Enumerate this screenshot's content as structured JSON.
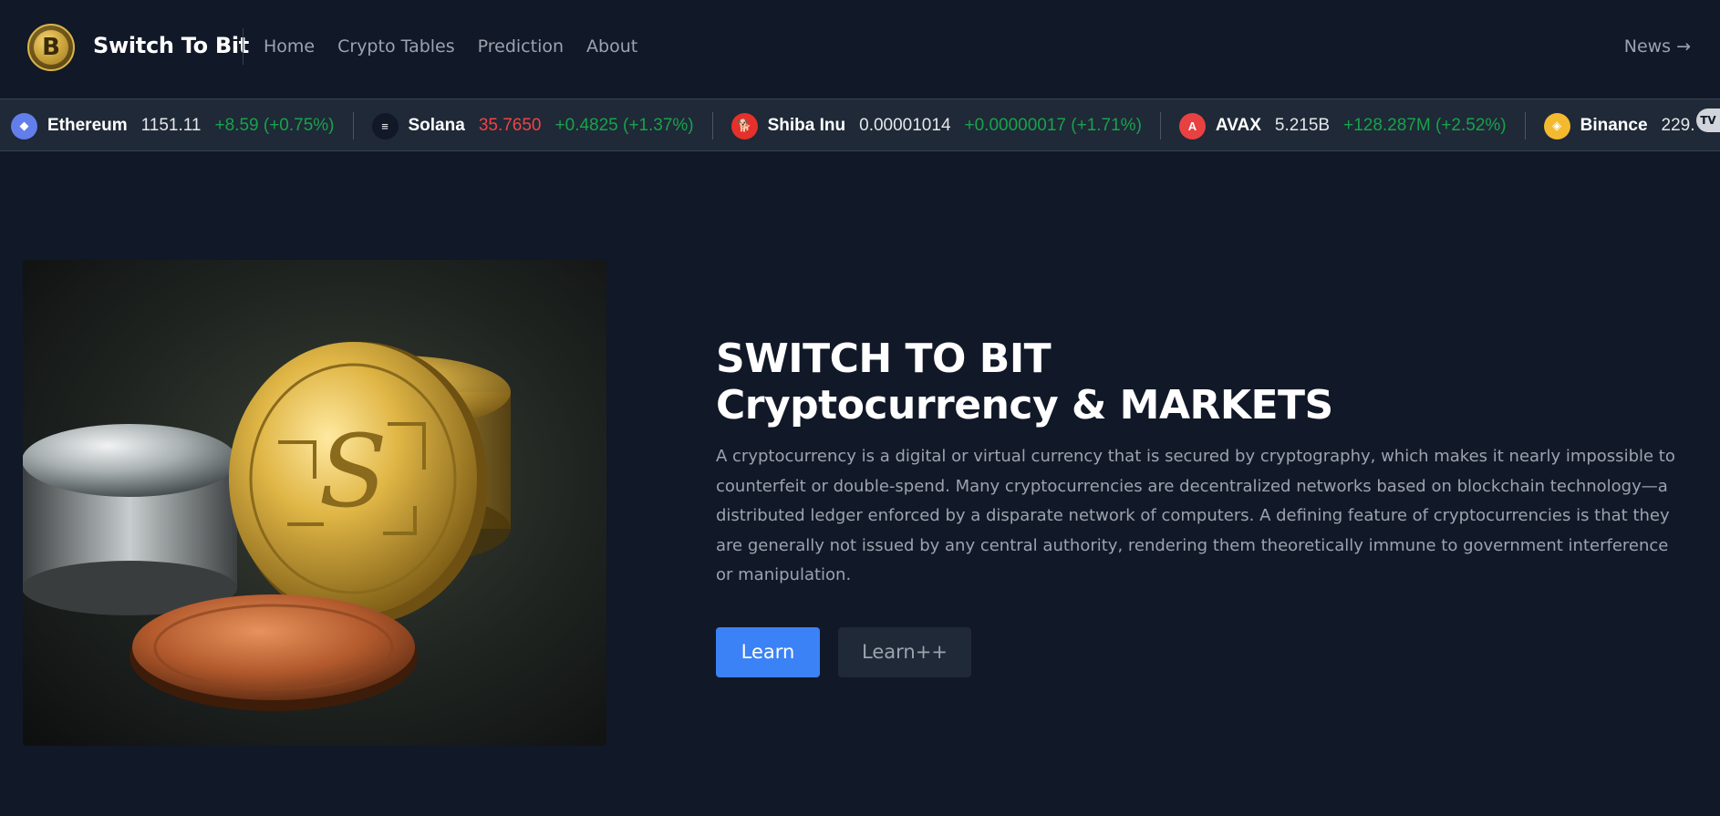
{
  "nav": {
    "logo_glyph": "B",
    "brand": "Switch To Bit",
    "links": [
      "Home",
      "Crypto Tables",
      "Prediction",
      "About"
    ],
    "news_label": "News",
    "news_arrow": "→"
  },
  "ticker": {
    "items": [
      {
        "icon": "ethereum-icon",
        "icon_glyph": "◆",
        "color": "#627eea",
        "name": "Ethereum",
        "price": "1151.11",
        "price_trend": "neutral",
        "change": "+8.59 (+0.75%)"
      },
      {
        "icon": "solana-icon",
        "icon_glyph": "≡",
        "color": "#111827",
        "name": "Solana",
        "price": "35.7650",
        "price_trend": "down",
        "change": "+0.4825 (+1.37%)"
      },
      {
        "icon": "shiba-inu-icon",
        "icon_glyph": "🐕",
        "color": "#e4312b",
        "name": "Shiba Inu",
        "price": "0.00001014",
        "price_trend": "neutral",
        "change": "+0.00000017 (+1.71%)"
      },
      {
        "icon": "avax-icon",
        "icon_glyph": "A",
        "color": "#e84142",
        "name": "AVAX",
        "price": "5.215B",
        "price_trend": "neutral",
        "change": "+128.287M (+2.52%)"
      },
      {
        "icon": "binance-icon",
        "icon_glyph": "◈",
        "color": "#f3ba2f",
        "name": "Binance",
        "price": "229.",
        "price_trend": "neutral",
        "change": ""
      }
    ],
    "badge": "TV"
  },
  "hero": {
    "title_line1": "SWITCH TO BIT",
    "title_line2": "Cryptocurrency & MARKETS",
    "description": "A cryptocurrency is a digital or virtual currency that is secured by cryptography, which makes it nearly impossible to counterfeit or double-spend. Many cryptocurrencies are decentralized networks based on blockchain technology—a distributed ledger enforced by a disparate network of computers. A defining feature of cryptocurrencies is that they are generally not issued by any central authority, rendering them theoretically immune to government interference or manipulation.",
    "primary_button": "Learn",
    "secondary_button": "Learn++"
  },
  "colors": {
    "background": "#111827",
    "ticker_bg": "#1f2937",
    "accent": "#3b82f6",
    "positive": "#16a34a",
    "negative": "#ef4444"
  }
}
